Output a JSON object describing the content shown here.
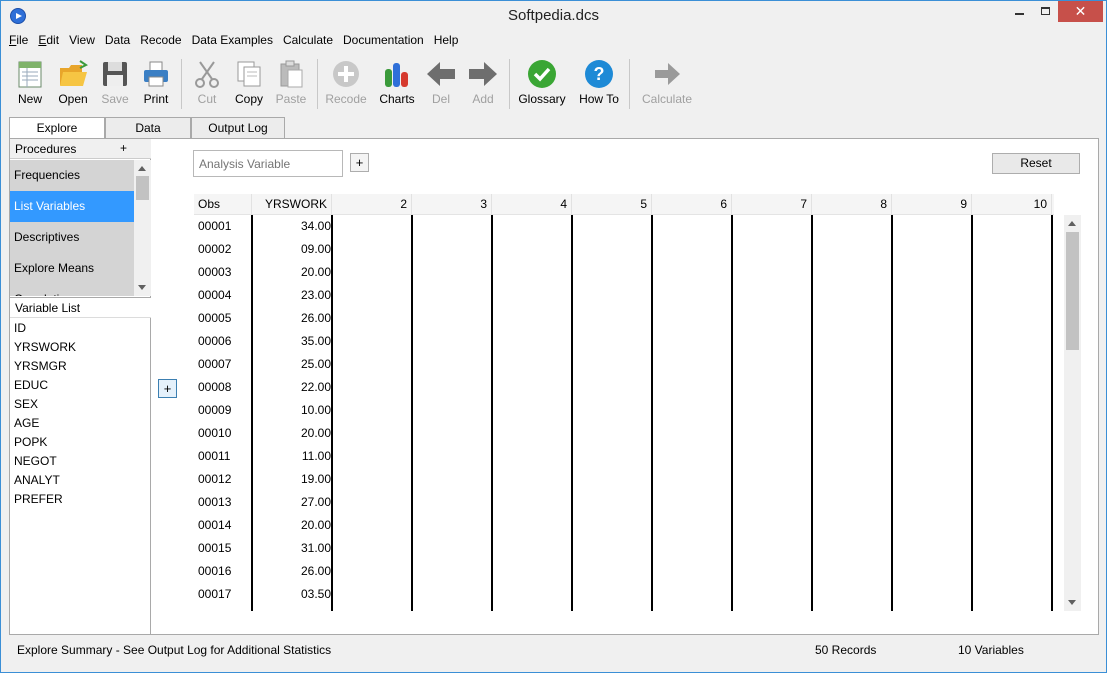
{
  "window": {
    "title": "Softpedia.dcs",
    "minimize": "–",
    "maximize": "",
    "close": "✕"
  },
  "menu": [
    "File",
    "Edit",
    "View",
    "Data",
    "Recode",
    "Data Examples",
    "Calculate",
    "Documentation",
    "Help"
  ],
  "menu_underline": [
    "F",
    "E",
    "",
    "",
    "",
    "",
    "",
    "",
    ""
  ],
  "toolbar": {
    "new": "New",
    "open": "Open",
    "save": "Save",
    "print": "Print",
    "cut": "Cut",
    "copy": "Copy",
    "paste": "Paste",
    "recode": "Recode",
    "charts": "Charts",
    "del": "Del",
    "add": "Add",
    "glossary": "Glossary",
    "howto": "How To",
    "calculate": "Calculate"
  },
  "tabs": [
    "Explore",
    "Data",
    "Output Log"
  ],
  "procedures": {
    "header": "Procedures",
    "add": "+",
    "items": [
      "Frequencies",
      "List Variables",
      "Descriptives",
      "Explore Means",
      "Correlation"
    ],
    "selected_index": 1
  },
  "variables": {
    "header": "Variable List",
    "items": [
      "ID",
      "YRSWORK",
      "YRSMGR",
      "EDUC",
      "SEX",
      "AGE",
      "POPK",
      "NEGOT",
      "ANALYT",
      "PREFER"
    ]
  },
  "analysis": {
    "placeholder": "Analysis Variable",
    "add": "+",
    "side_add": "+",
    "reset": "Reset"
  },
  "grid": {
    "headers": [
      "Obs",
      "YRSWORK",
      "2",
      "3",
      "4",
      "5",
      "6",
      "7",
      "8",
      "9",
      "10"
    ],
    "rows": [
      [
        "00001",
        "34.00"
      ],
      [
        "00002",
        "09.00"
      ],
      [
        "00003",
        "20.00"
      ],
      [
        "00004",
        "23.00"
      ],
      [
        "00005",
        "26.00"
      ],
      [
        "00006",
        "35.00"
      ],
      [
        "00007",
        "25.00"
      ],
      [
        "00008",
        "22.00"
      ],
      [
        "00009",
        "10.00"
      ],
      [
        "00010",
        "20.00"
      ],
      [
        "00011",
        "11.00"
      ],
      [
        "00012",
        "19.00"
      ],
      [
        "00013",
        "27.00"
      ],
      [
        "00014",
        "20.00"
      ],
      [
        "00015",
        "31.00"
      ],
      [
        "00016",
        "26.00"
      ],
      [
        "00017",
        "03.50"
      ]
    ]
  },
  "status": {
    "summary": "Explore Summary  -  See Output Log for Additional Statistics",
    "records": "50 Records",
    "variables": "10 Variables"
  },
  "watermark": "SOFTPEDIA",
  "colors": {
    "selection": "#3399ff",
    "close_button": "#c7504a",
    "glossary_green": "#3aa634",
    "howto_blue": "#1e8ad6"
  }
}
